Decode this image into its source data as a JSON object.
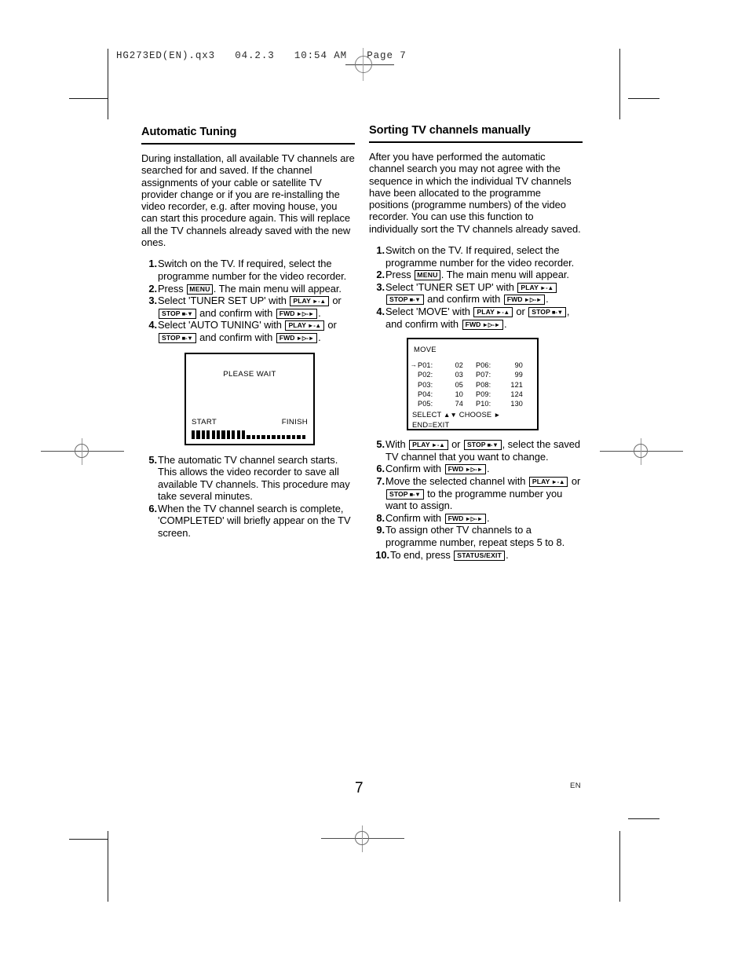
{
  "print_header": {
    "text": "HG273ED(EN).qx3   04.2.3   10:54 AM   Page 7"
  },
  "footer": {
    "page_number": "7",
    "language": "EN"
  },
  "left_column": {
    "title": "Automatic Tuning",
    "intro": "During installation, all available TV channels are searched for and saved. If the channel assignments of your cable or satellite TV provider change or if you are re-installing the video recorder, e.g. after moving house, you can start this procedure again. This will replace all the TV channels already saved with the new ones.",
    "steps": [
      {
        "num": "1.",
        "parts": [
          {
            "type": "text",
            "value": "Switch on the TV. If required, select the programme number for the video recorder."
          }
        ]
      },
      {
        "num": "2.",
        "parts": [
          {
            "type": "text",
            "value": "Press "
          },
          {
            "type": "key",
            "value": "MENU"
          },
          {
            "type": "text",
            "value": ". The main menu will appear."
          }
        ]
      },
      {
        "num": "3.",
        "parts": [
          {
            "type": "text",
            "value": "Select 'TUNER SET UP' with "
          },
          {
            "type": "key",
            "value": "PLAY",
            "arrows": "►-▲"
          },
          {
            "type": "text",
            "value": " or "
          },
          {
            "type": "key",
            "value": "STOP",
            "arrows": "■-▼"
          },
          {
            "type": "text",
            "value": " and confirm with "
          },
          {
            "type": "key",
            "value": "FWD",
            "arrows": "►▷-►"
          },
          {
            "type": "text",
            "value": "."
          }
        ]
      },
      {
        "num": "4.",
        "parts": [
          {
            "type": "text",
            "value": "Select 'AUTO TUNING' with "
          },
          {
            "type": "key",
            "value": "PLAY",
            "arrows": "►-▲"
          },
          {
            "type": "text",
            "value": " or "
          },
          {
            "type": "key",
            "value": "STOP",
            "arrows": "■-▼"
          },
          {
            "type": "text",
            "value": " and confirm with "
          },
          {
            "type": "key",
            "value": "FWD",
            "arrows": "►▷-►"
          },
          {
            "type": "text",
            "value": "."
          }
        ]
      }
    ],
    "steps_after": [
      {
        "num": "5.",
        "parts": [
          {
            "type": "text",
            "value": "The automatic TV channel search starts. This allows the video recorder to save all available TV channels. This procedure may take several minutes."
          }
        ]
      },
      {
        "num": "6.",
        "parts": [
          {
            "type": "text",
            "value": "When the TV channel search is complete, 'COMPLETED' will briefly appear on the TV screen."
          }
        ]
      }
    ],
    "tv_screen": {
      "message": "PLEASE WAIT",
      "start_label": "START",
      "finish_label": "FINISH",
      "progress_filled": 11,
      "progress_empty": 12
    }
  },
  "right_column": {
    "title": "Sorting TV channels manually",
    "intro": "After you have performed the automatic channel search you may not agree with the sequence in which the individual TV channels have been allocated to the programme positions (programme numbers) of the video recorder. You can use this function to individually sort the TV channels already saved.",
    "steps": [
      {
        "num": "1.",
        "parts": [
          {
            "type": "text",
            "value": "Switch on the TV. If required, select the programme number for the video recorder."
          }
        ]
      },
      {
        "num": "2.",
        "parts": [
          {
            "type": "text",
            "value": "Press "
          },
          {
            "type": "key",
            "value": "MENU"
          },
          {
            "type": "text",
            "value": ". The main menu will appear."
          }
        ]
      },
      {
        "num": "3.",
        "parts": [
          {
            "type": "text",
            "value": "Select 'TUNER SET UP' with "
          },
          {
            "type": "key",
            "value": "PLAY",
            "arrows": "►-▲"
          },
          {
            "type": "text",
            "value": " "
          },
          {
            "type": "key",
            "value": "STOP",
            "arrows": "■-▼"
          },
          {
            "type": "text",
            "value": " and confirm with "
          },
          {
            "type": "key",
            "value": "FWD",
            "arrows": "►▷-►"
          },
          {
            "type": "text",
            "value": "."
          }
        ]
      },
      {
        "num": "4.",
        "parts": [
          {
            "type": "text",
            "value": "Select 'MOVE' with "
          },
          {
            "type": "key",
            "value": "PLAY",
            "arrows": "►-▲"
          },
          {
            "type": "text",
            "value": " or "
          },
          {
            "type": "key",
            "value": "STOP",
            "arrows": "■-▼"
          },
          {
            "type": "text",
            "value": ", and confirm with "
          },
          {
            "type": "key",
            "value": "FWD",
            "arrows": "►▷-►"
          },
          {
            "type": "text",
            "value": "."
          }
        ]
      }
    ],
    "steps_after": [
      {
        "num": "5.",
        "parts": [
          {
            "type": "text",
            "value": "With "
          },
          {
            "type": "key",
            "value": "PLAY",
            "arrows": "►-▲"
          },
          {
            "type": "text",
            "value": " or "
          },
          {
            "type": "key",
            "value": "STOP",
            "arrows": "■-▼"
          },
          {
            "type": "text",
            "value": ", select the saved TV channel that you want to change."
          }
        ]
      },
      {
        "num": "6.",
        "parts": [
          {
            "type": "text",
            "value": "Confirm with "
          },
          {
            "type": "key",
            "value": "FWD",
            "arrows": "►▷-►"
          },
          {
            "type": "text",
            "value": "."
          }
        ]
      },
      {
        "num": "7.",
        "parts": [
          {
            "type": "text",
            "value": "Move the selected channel with "
          },
          {
            "type": "key",
            "value": "PLAY",
            "arrows": "►-▲"
          },
          {
            "type": "text",
            "value": " or "
          },
          {
            "type": "key",
            "value": "STOP",
            "arrows": "■-▼"
          },
          {
            "type": "text",
            "value": " to the programme number you want to assign."
          }
        ]
      },
      {
        "num": "8.",
        "parts": [
          {
            "type": "text",
            "value": "Confirm with "
          },
          {
            "type": "key",
            "value": "FWD",
            "arrows": "►▷-►"
          },
          {
            "type": "text",
            "value": "."
          }
        ]
      },
      {
        "num": "9.",
        "parts": [
          {
            "type": "text",
            "value": "To assign other TV channels to a programme number, repeat steps 5 to 8."
          }
        ]
      },
      {
        "num": "10.",
        "wide": true,
        "parts": [
          {
            "type": "text",
            "value": "To end, press "
          },
          {
            "type": "key",
            "value": "STATUS/EXIT"
          },
          {
            "type": "text",
            "value": "."
          }
        ]
      }
    ],
    "tv_screen": {
      "title": "MOVE",
      "cursor_row": 0,
      "rows": [
        {
          "left_prog": "P01:",
          "left_val": "02",
          "right_prog": "P06:",
          "right_val": "90"
        },
        {
          "left_prog": "P02:",
          "left_val": "03",
          "right_prog": "P07:",
          "right_val": "99"
        },
        {
          "left_prog": "P03:",
          "left_val": "05",
          "right_prog": "P08:",
          "right_val": "121"
        },
        {
          "left_prog": "P04:",
          "left_val": "10",
          "right_prog": "P09:",
          "right_val": "124"
        },
        {
          "left_prog": "P05:",
          "left_val": "74",
          "right_prog": "P10:",
          "right_val": "130"
        }
      ],
      "footer_select": "SELECT",
      "footer_choose": "CHOOSE",
      "footer_end": "END=EXIT"
    }
  }
}
